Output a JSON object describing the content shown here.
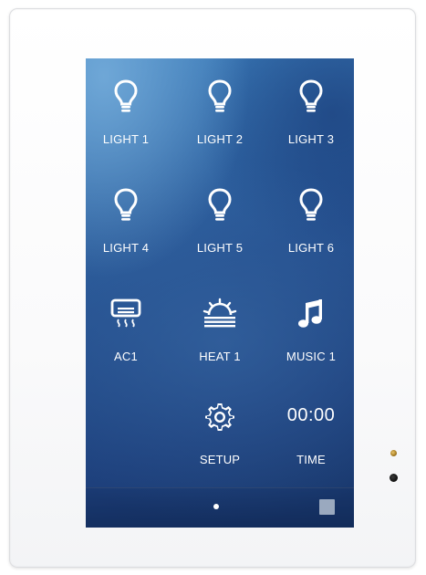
{
  "panel": {
    "tiles": [
      {
        "label": "LIGHT 1",
        "icon": "light-bulb-icon"
      },
      {
        "label": "LIGHT 2",
        "icon": "light-bulb-icon"
      },
      {
        "label": "LIGHT 3",
        "icon": "light-bulb-icon"
      },
      {
        "label": "LIGHT 4",
        "icon": "light-bulb-icon"
      },
      {
        "label": "LIGHT 5",
        "icon": "light-bulb-icon"
      },
      {
        "label": "LIGHT 6",
        "icon": "light-bulb-icon"
      },
      {
        "label": "AC1",
        "icon": "air-conditioner-icon"
      },
      {
        "label": "HEAT 1",
        "icon": "heater-icon"
      },
      {
        "label": "MUSIC 1",
        "icon": "music-note-icon"
      },
      {
        "label": "SETUP",
        "icon": "gear-icon"
      },
      {
        "label": "TIME",
        "value": "00:00"
      }
    ],
    "dock": {
      "page_indicator": "dot-icon",
      "home_button": "square-icon"
    },
    "colors": {
      "screen_top": "#3d7fbd",
      "screen_bottom": "#183669",
      "text": "#ffffff",
      "led": "#c89a35"
    }
  }
}
